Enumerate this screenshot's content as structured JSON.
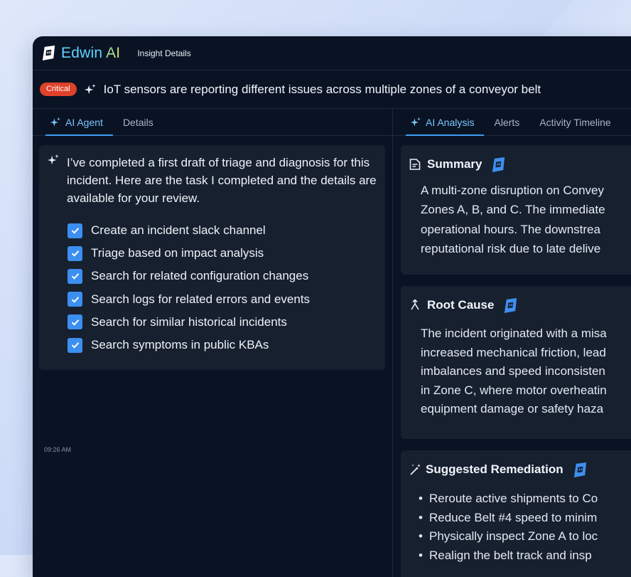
{
  "app": {
    "brand_main": "Edwin",
    "brand_ai": " AI",
    "breadcrumb": "Insight Details"
  },
  "insight": {
    "severity": "Critical",
    "title": "IoT sensors are reporting different issues across multiple zones of a conveyor belt"
  },
  "left_tabs": [
    {
      "label": "AI Agent",
      "active": true
    },
    {
      "label": "Details",
      "active": false
    }
  ],
  "chat": {
    "intro": "I’ve completed a first draft of triage and diagnosis for this incident. Here are the task I completed and the details are available for your review.",
    "tasks": [
      "Create an incident slack channel",
      "Triage based on impact analysis",
      "Search for related configuration changes",
      "Search logs for related errors and events",
      "Search for similar historical incidents",
      "Search symptoms in public KBAs"
    ],
    "timestamp": "09:26 AM"
  },
  "right_tabs": [
    {
      "label": "AI Analysis",
      "active": true
    },
    {
      "label": "Alerts",
      "active": false
    },
    {
      "label": "Activity Timeline",
      "active": false
    }
  ],
  "summary": {
    "title": "Summary",
    "lines": [
      "A multi-zone disruption on Convey",
      "Zones A, B, and C. The immediate",
      "operational hours. The downstrea",
      "reputational risk due to late delive"
    ]
  },
  "root_cause": {
    "title": "Root Cause",
    "lines": [
      "The incident originated with a misa",
      "increased mechanical friction, lead",
      "imbalances and speed inconsisten",
      "in Zone C, where motor overheatin",
      "equipment damage or safety haza"
    ]
  },
  "remediation": {
    "title": "Suggested Remediation",
    "items": [
      "Reroute active shipments to Co",
      "Reduce Belt #4 speed to minim",
      "Physically inspect Zone A to loc",
      "Realign the belt track and insp"
    ]
  },
  "colors": {
    "accent": "#3f9cf0",
    "critical": "#e0412b",
    "background": "#0a1324",
    "card": "#17202f"
  }
}
